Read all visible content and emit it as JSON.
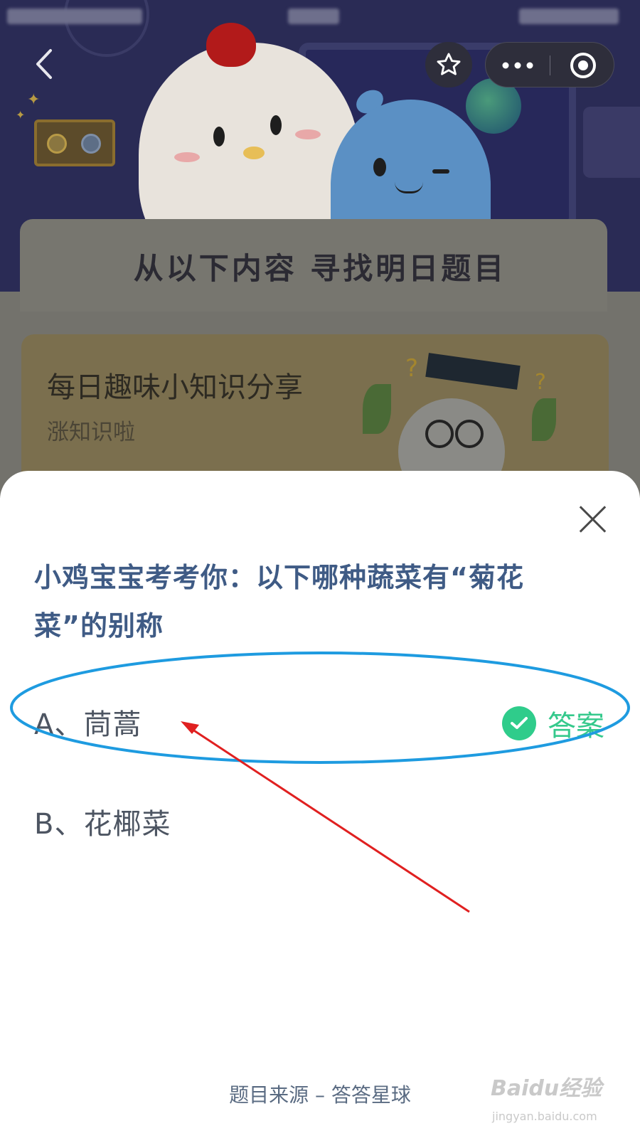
{
  "background": {
    "section_title": "从以下内容 寻找明日题目",
    "knowledge_card": {
      "title": "每日趣味小知识分享",
      "subtitle": "涨知识啦"
    }
  },
  "nav": {
    "back_icon": "chevron-left-icon",
    "favorite_icon": "star-outline-icon",
    "more_icon": "more-dots-icon",
    "close_miniapp_icon": "target-circle-icon"
  },
  "quiz": {
    "question": "小鸡宝宝考考你：以下哪种蔬菜有“菊花菜”的别称",
    "options": [
      {
        "label": "A、茼蒿",
        "is_answer": true
      },
      {
        "label": "B、花椰菜",
        "is_answer": false
      }
    ],
    "answer_label": "答案",
    "source": "题目来源 – 答答星球"
  },
  "watermark": {
    "brand": "Baidu经验",
    "url": "jingyan.baidu.com"
  },
  "colors": {
    "question_text": "#3f5b85",
    "answer_green": "#2fcc8b",
    "highlight_blue": "#1e9be0",
    "arrow_red": "#e02020"
  }
}
